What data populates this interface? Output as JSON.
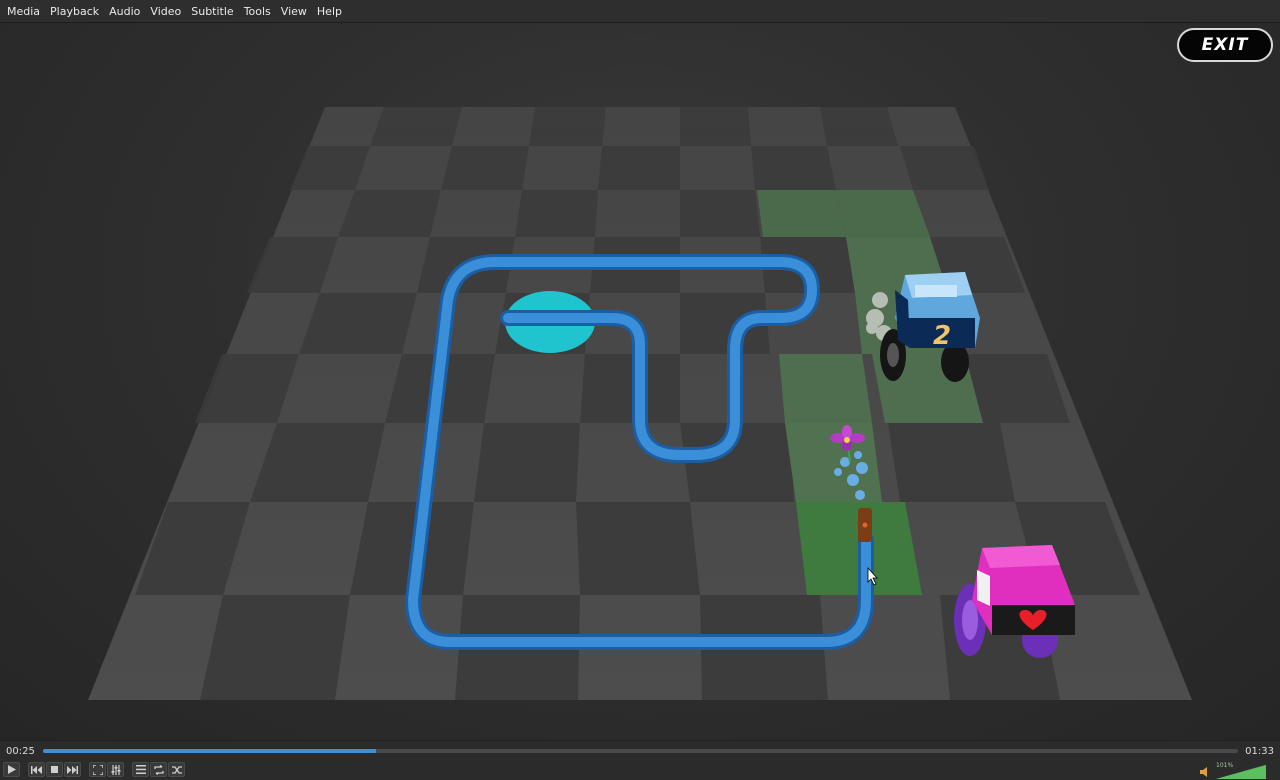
{
  "menu": {
    "items": [
      "Media",
      "Playback",
      "Audio",
      "Video",
      "Subtitle",
      "Tools",
      "View",
      "Help"
    ]
  },
  "game": {
    "exit_label": "EXIT",
    "truck_number": "2"
  },
  "player": {
    "elapsed": "00:25",
    "total": "01:33",
    "progress_fraction": 0.279,
    "volume_label": "101%",
    "volume_fraction": 1.0
  },
  "colors": {
    "accent": "#3d8fd6",
    "water": "#2f7fc9",
    "pool": "#1fc4cf",
    "truck_blue": "#5fa7dc",
    "truck_pink": "#e02fbf",
    "tile_green": "#3f7a3f"
  },
  "icons": {
    "play": "play-icon",
    "previous": "previous-icon",
    "stop": "stop-icon",
    "next": "next-icon",
    "fullscreen": "fullscreen-icon",
    "extended": "equalizer-icon",
    "playlist": "playlist-icon",
    "loop": "loop-icon",
    "shuffle": "shuffle-icon",
    "volume": "speaker-icon"
  }
}
